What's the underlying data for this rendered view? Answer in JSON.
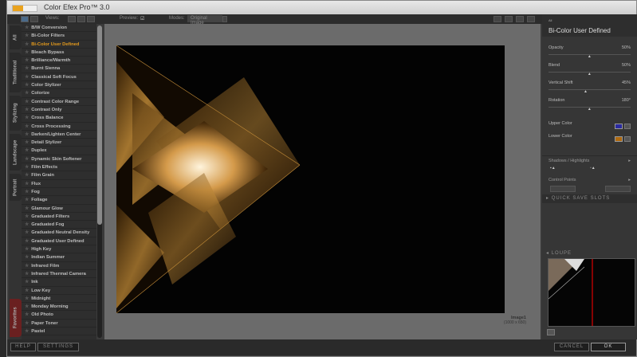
{
  "app": {
    "title": "Color Efex Pro™ 3.0"
  },
  "toolbar": {
    "views_label": "Views:",
    "preview_label": "Preview:",
    "preview_checked": true,
    "modes_label": "Modes:",
    "mode_value": "Original Image"
  },
  "tabs": [
    "All",
    "Traditional",
    "Stylizing",
    "Landscape",
    "Portrait",
    "Favorites"
  ],
  "filters": [
    "B/W Conversion",
    "Bi-Color Filters",
    "Bi-Color User Defined",
    "Bleach Bypass",
    "Brilliance/Warmth",
    "Burnt Sienna",
    "Classical Soft Focus",
    "Color Stylizer",
    "Colorize",
    "Contrast Color Range",
    "Contrast Only",
    "Cross Balance",
    "Cross Processing",
    "Darken/Lighten Center",
    "Detail Stylizer",
    "Duplex",
    "Dynamic Skin Softener",
    "Film Effects",
    "Film Grain",
    "Flux",
    "Fog",
    "Foliage",
    "Glamour Glow",
    "Graduated Filters",
    "Graduated Fog",
    "Graduated Neutral Density",
    "Graduated User Defined",
    "High Key",
    "Indian Summer",
    "Infrared Film",
    "Infrared Thermal Camera",
    "Ink",
    "Low Key",
    "Midnight",
    "Monday Morning",
    "Old Photo",
    "Paper Toner",
    "Pastel"
  ],
  "selected_filter": "Bi-Color User Defined",
  "image": {
    "name": "Image1",
    "size": "(1000 x 650)"
  },
  "panel": {
    "category": "All",
    "filter_name": "Bi-Color User Defined",
    "params": [
      {
        "label": "Opacity",
        "value": "50%",
        "pos": 50
      },
      {
        "label": "Blend",
        "value": "50%",
        "pos": 50
      },
      {
        "label": "Vertical Shift",
        "value": "45%",
        "pos": 45
      },
      {
        "label": "Rotation",
        "value": "180°",
        "pos": 50
      }
    ],
    "upper_color_label": "Upper Color",
    "upper_color": "#2a2aa0",
    "lower_color_label": "Lower Color",
    "lower_color": "#b06a10",
    "shadows_label": "Shadows / Highlights",
    "control_points_label": "Control Points",
    "quick_save_label": "QUICK SAVE SLOTS",
    "loupe_label": "LOUPE"
  },
  "buttons": {
    "help": "HELP",
    "settings": "SETTINGS",
    "cancel": "CANCEL",
    "ok": "OK"
  },
  "colors": {
    "accent": "#e49a1c"
  }
}
